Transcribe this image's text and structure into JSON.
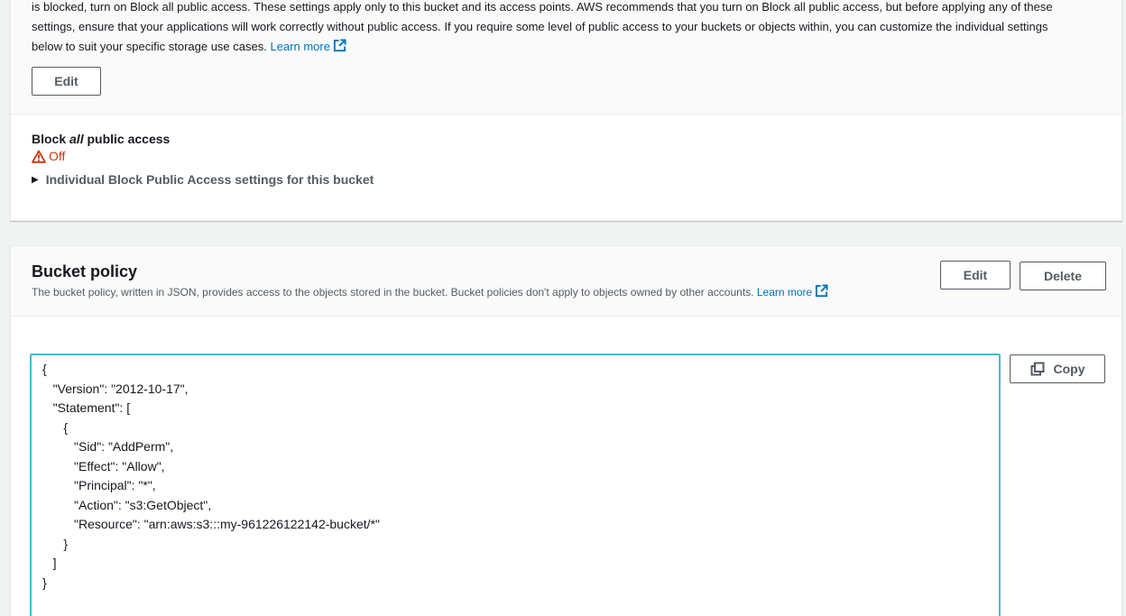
{
  "block_public_access": {
    "description_line1": "is blocked, turn on Block all public access. These settings apply only to this bucket and its access points. AWS recommends that you turn on Block all public access, but before applying any of these",
    "description_line2": "settings, ensure that your applications will work correctly without public access. If you require some level of public access to your buckets or objects within, you can customize the individual settings",
    "description_line3": "below to suit your specific storage use cases.",
    "learn_more": "Learn more",
    "edit_label": "Edit",
    "label_prefix": "Block ",
    "label_emphasis": "all",
    "label_suffix": " public access",
    "status": "Off",
    "expander_label": "Individual Block Public Access settings for this bucket"
  },
  "bucket_policy": {
    "title": "Bucket policy",
    "description": "The bucket policy, written in JSON, provides access to the objects stored in the bucket. Bucket policies don't apply to objects owned by other accounts.",
    "learn_more": "Learn more",
    "edit_label": "Edit",
    "delete_label": "Delete",
    "copy_label": "Copy",
    "policy_text": "{\n   \"Version\": \"2012-10-17\",\n   \"Statement\": [\n      {\n         \"Sid\": \"AddPerm\",\n         \"Effect\": \"Allow\",\n         \"Principal\": \"*\",\n         \"Action\": \"s3:GetObject\",\n         \"Resource\": \"arn:aws:s3:::my-961226122142-bucket/*\"\n      }\n   ]\n}"
  },
  "icons": {
    "external_link": "external-link-icon",
    "warning": "warning-icon",
    "caret": "caret-right-icon",
    "copy": "copy-icon"
  },
  "colors": {
    "link": "#0073bb",
    "warning": "#d13212",
    "focus_border": "#44b9d6"
  }
}
